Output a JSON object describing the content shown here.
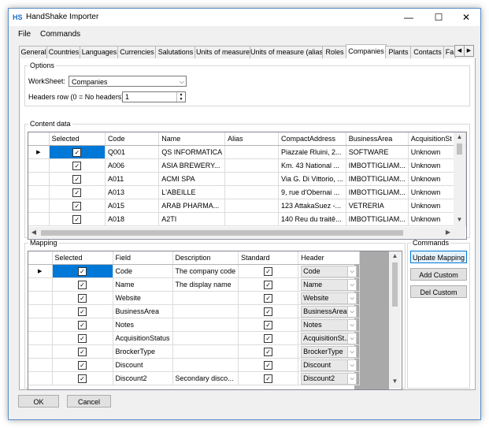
{
  "window": {
    "title": "HandShake Importer",
    "icon_text": "HS"
  },
  "titlebar_buttons": {
    "minimize": "—",
    "maximize": "☐",
    "close": "✕"
  },
  "menu": [
    "File",
    "Commands"
  ],
  "tabs": [
    "General",
    "Countries",
    "Languages",
    "Currencies",
    "Salutations",
    "Units of measure",
    "Units of measure (alias)",
    "Roles",
    "Companies",
    "Plants",
    "Contacts",
    "Fa"
  ],
  "active_tab": "Companies",
  "options": {
    "legend": "Options",
    "worksheet_label": "WorkSheet:",
    "worksheet_value": "Companies",
    "headers_row_label": "Headers row (0 = No headers):",
    "headers_row_value": "1"
  },
  "content": {
    "legend": "Content data",
    "columns": [
      "Selected",
      "Code",
      "Name",
      "Alias",
      "CompactAddress",
      "BusinessArea",
      "AcquisitionSt"
    ],
    "rows": [
      {
        "code": "Q001",
        "name": "QS INFORMATICA",
        "alias": "",
        "address": "Piazzale Rluini, 2...",
        "area": "SOFTWARE",
        "status": "Unknown"
      },
      {
        "code": "A006",
        "name": "ASIA BREWERY...",
        "alias": "",
        "address": "Km. 43 National ...",
        "area": "IMBOTTIGLIAM...",
        "status": "Unknown"
      },
      {
        "code": "A011",
        "name": "ACMI SPA",
        "alias": "",
        "address": "Via G. Di Vittorio, ...",
        "area": "IMBOTTIGLIAM...",
        "status": "Unknown"
      },
      {
        "code": "A013",
        "name": "L'ABEILLE",
        "alias": "",
        "address": "9, rue d'Obernai ...",
        "area": "IMBOTTIGLIAM...",
        "status": "Unknown"
      },
      {
        "code": "A015",
        "name": "ARAB PHARMA...",
        "alias": "",
        "address": "123 AttakaSuez -...",
        "area": "VETRERIA",
        "status": "Unknown"
      },
      {
        "code": "A018",
        "name": "A2TI",
        "alias": "",
        "address": "140 Reu du traitê...",
        "area": "IMBOTTIGLIAM...",
        "status": "Unknown"
      }
    ]
  },
  "mapping": {
    "legend": "Mapping",
    "columns": [
      "Selected",
      "Field",
      "Description",
      "Standard",
      "Header"
    ],
    "rows": [
      {
        "field": "Code",
        "description": "The company code",
        "header": "Code"
      },
      {
        "field": "Name",
        "description": "The display name",
        "header": "Name"
      },
      {
        "field": "Website",
        "description": "",
        "header": "Website"
      },
      {
        "field": "BusinessArea",
        "description": "",
        "header": "BusinessArea"
      },
      {
        "field": "Notes",
        "description": "",
        "header": "Notes"
      },
      {
        "field": "AcquisitionStatus",
        "description": "",
        "header": "AcquisitionSt..."
      },
      {
        "field": "BrockerType",
        "description": "",
        "header": "BrockerType"
      },
      {
        "field": "Discount",
        "description": "",
        "header": "Discount"
      },
      {
        "field": "Discount2",
        "description": "Secondary disco...",
        "header": "Discount2"
      }
    ]
  },
  "commands": {
    "legend": "Commands",
    "update": "Update Mapping",
    "add": "Add Custom",
    "del": "Del Custom"
  },
  "footer": {
    "ok": "OK",
    "cancel": "Cancel"
  },
  "colors": {
    "selection": "#0078d7",
    "border_accent": "#5a8fc7"
  }
}
